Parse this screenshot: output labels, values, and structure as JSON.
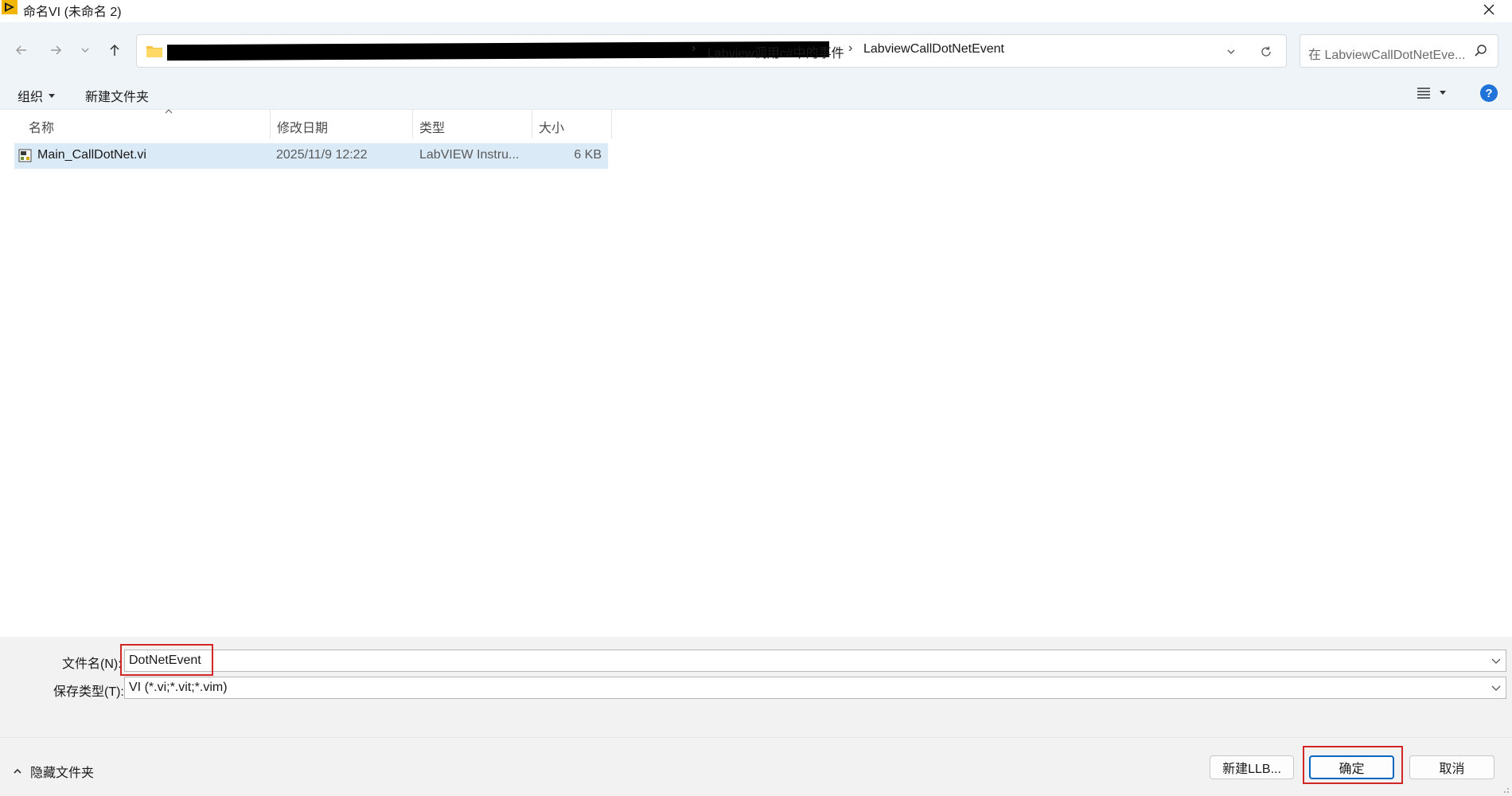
{
  "window": {
    "title": "命名VI (未命名 2)",
    "app_icon": "labview-icon",
    "close_icon": "close-icon"
  },
  "navigation": {
    "back_icon": "arrow-left-icon",
    "forward_icon": "arrow-right-icon",
    "recent_icon": "chevron-down-icon",
    "up_icon": "arrow-up-icon"
  },
  "address": {
    "folder_icon": "folder-icon",
    "crumbs": [
      "Labview调用c#中的事件",
      "LabviewCallDotNetEvent"
    ],
    "separator": "›",
    "dropdown_icon": "chevron-down-icon",
    "refresh_icon": "refresh-icon"
  },
  "search": {
    "placeholder": "在 LabviewCallDotNetEve...",
    "icon": "search-icon"
  },
  "toolbar": {
    "organize_label": "组织",
    "new_folder_label": "新建文件夹",
    "view_icon": "list-view-icon",
    "help_label": "?"
  },
  "columns": {
    "name": "名称",
    "modified": "修改日期",
    "type": "类型",
    "size": "大小"
  },
  "files": [
    {
      "name": "Main_CallDotNet.vi",
      "modified": "2025/11/9 12:22",
      "type": "LabVIEW Instru...",
      "size": "6 KB",
      "icon": "vi-file-icon"
    }
  ],
  "form": {
    "filename_label": "文件名(N):",
    "filename_value": "DotNetEvent",
    "filetype_label": "保存类型(T):",
    "filetype_value": "VI (*.vi;*.vit;*.vim)"
  },
  "footer": {
    "hide_folders_label": "隐藏文件夹",
    "new_llb_label": "新建LLB...",
    "ok_label": "确定",
    "cancel_label": "取消"
  },
  "colors": {
    "highlight": "#d32626",
    "accent": "#0067c0",
    "selection": "#dbeaf7"
  }
}
